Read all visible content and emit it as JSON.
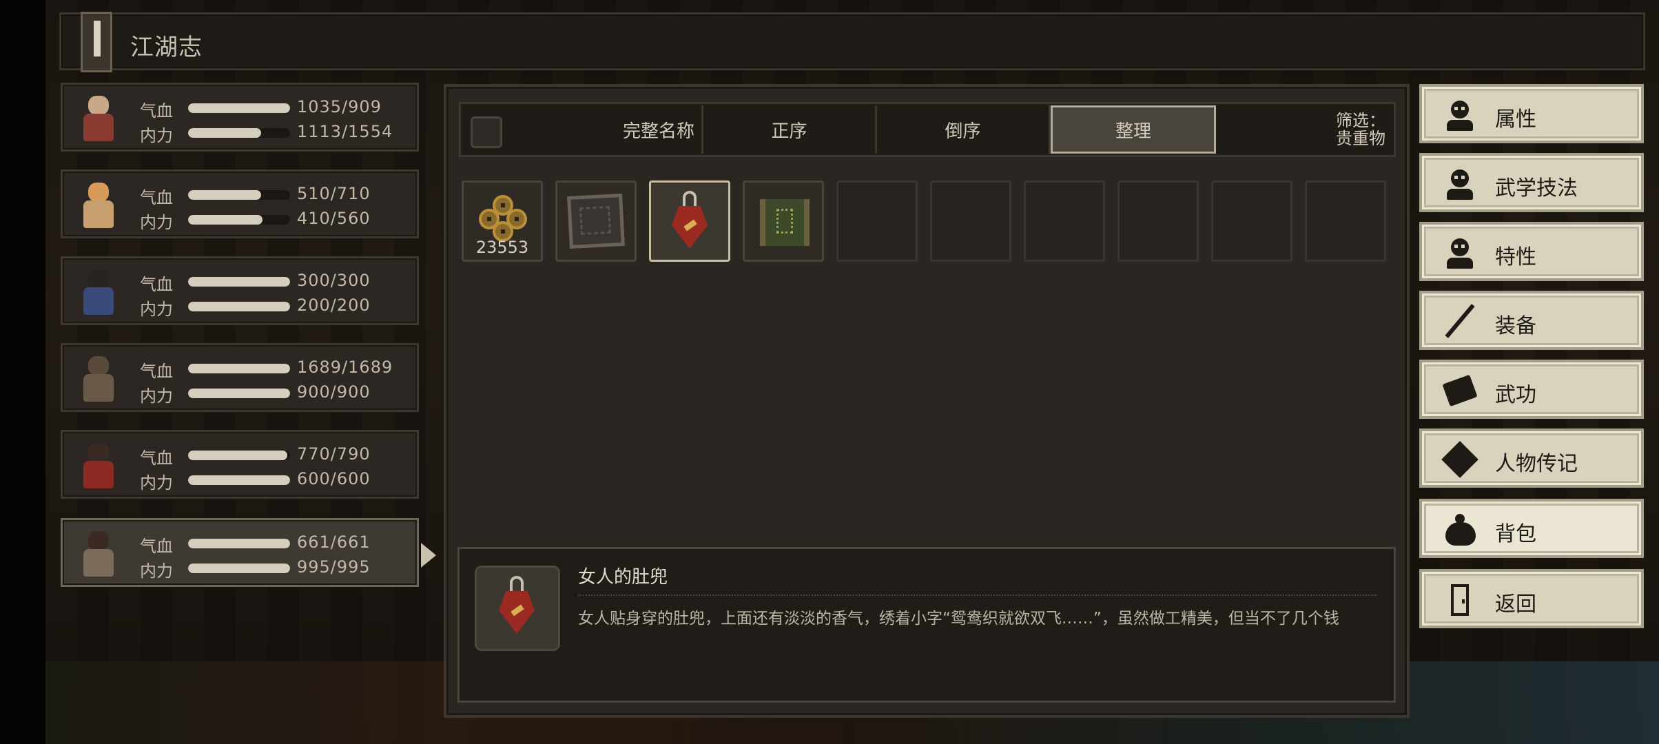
{
  "window": {
    "title": "江湖志"
  },
  "characters": [
    {
      "hp": {
        "label": "气血",
        "value": "1035/909",
        "fill": 1.0
      },
      "mp": {
        "label": "内力",
        "value": "1113/1554",
        "fill": 0.716
      },
      "colors": {
        "head": "#c8a888",
        "body": "#8a3a30"
      }
    },
    {
      "hp": {
        "label": "气血",
        "value": "510/710",
        "fill": 0.718
      },
      "mp": {
        "label": "内力",
        "value": "410/560",
        "fill": 0.732
      },
      "colors": {
        "head": "#d89a58",
        "body": "#c8a070"
      }
    },
    {
      "hp": {
        "label": "气血",
        "value": "300/300",
        "fill": 1.0
      },
      "mp": {
        "label": "内力",
        "value": "200/200",
        "fill": 1.0
      },
      "colors": {
        "head": "#2a2420",
        "body": "#3a4a7a"
      }
    },
    {
      "hp": {
        "label": "气血",
        "value": "1689/1689",
        "fill": 1.0
      },
      "mp": {
        "label": "内力",
        "value": "900/900",
        "fill": 1.0
      },
      "colors": {
        "head": "#5a4a3a",
        "body": "#6a5a4a"
      }
    },
    {
      "hp": {
        "label": "气血",
        "value": "770/790",
        "fill": 0.975
      },
      "mp": {
        "label": "内力",
        "value": "600/600",
        "fill": 1.0
      },
      "colors": {
        "head": "#3a2a22",
        "body": "#8a2a22"
      }
    },
    {
      "hp": {
        "label": "气血",
        "value": "661/661",
        "fill": 1.0
      },
      "mp": {
        "label": "内力",
        "value": "995/995",
        "fill": 1.0
      },
      "colors": {
        "head": "#3a2a22",
        "body": "#7a6a5a"
      },
      "selected": true
    }
  ],
  "inventory": {
    "tabs": {
      "full_name": "完整名称",
      "ascending": "正序",
      "descending": "倒序",
      "organize": "整理",
      "filter_label": "筛选：",
      "filter_value": "贵重物"
    },
    "active_tab": "organize",
    "slots": [
      {
        "icon": "copper-coins-icon",
        "count": "23553"
      },
      {
        "icon": "treasure-map-icon"
      },
      {
        "icon": "red-dudou-icon",
        "selected": true
      },
      {
        "icon": "green-scroll-icon"
      },
      {},
      {},
      {},
      {},
      {},
      {}
    ],
    "detail": {
      "name": "女人的肚兜",
      "description": "女人贴身穿的肚兜，上面还有淡淡的香气，绣着小字“鸳鸯织就欲双飞……”，虽然做工精美，但当不了几个钱",
      "icon": "red-dudou-icon"
    }
  },
  "menu": {
    "items": [
      {
        "label": "属性",
        "icon": "person-icon"
      },
      {
        "label": "武学技法",
        "icon": "person-sparkle-icon"
      },
      {
        "label": "特性",
        "icon": "person-heart-icon"
      },
      {
        "label": "装备",
        "icon": "sword-icon"
      },
      {
        "label": "武功",
        "icon": "book-icon"
      },
      {
        "label": "人物传记",
        "icon": "biography-icon"
      },
      {
        "label": "背包",
        "icon": "bag-icon",
        "active": true
      },
      {
        "label": "返回",
        "icon": "door-icon"
      }
    ]
  }
}
